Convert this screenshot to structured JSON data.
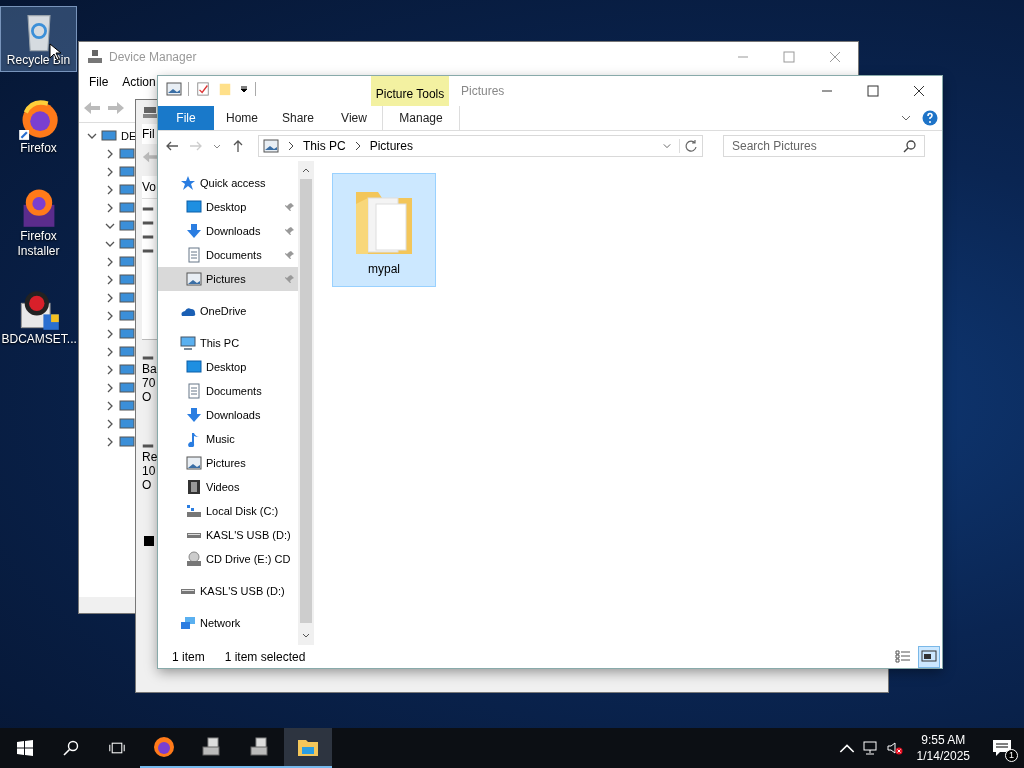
{
  "desktop_icons": [
    {
      "label": "Recycle Bin",
      "kind": "recycle-bin",
      "selected": true
    },
    {
      "label": "Firefox",
      "kind": "firefox",
      "selected": false
    },
    {
      "label": "Firefox Installer",
      "kind": "installer",
      "selected": false
    },
    {
      "label": "BDCAMSET...",
      "kind": "setup",
      "selected": false
    }
  ],
  "device_manager": {
    "title": "Device Manager",
    "menu": [
      "File",
      "Action"
    ],
    "tree": [
      {
        "label": "DE",
        "expanded": true
      },
      {
        "expanded": false
      },
      {
        "expanded": false
      },
      {
        "expanded": false
      },
      {
        "expanded": false
      },
      {
        "expanded": true
      },
      {
        "expanded": true
      },
      {
        "expanded": false
      },
      {
        "expanded": false
      },
      {
        "expanded": false
      },
      {
        "expanded": false
      },
      {
        "expanded": false
      },
      {
        "expanded": false
      },
      {
        "expanded": false
      },
      {
        "expanded": false
      },
      {
        "expanded": false
      },
      {
        "expanded": false
      },
      {
        "expanded": false
      }
    ]
  },
  "second_window": {
    "menu": "Fil",
    "column": "Vo",
    "details": [
      [
        "Ba",
        "70",
        "O"
      ],
      [
        "Re",
        "10",
        "O"
      ]
    ]
  },
  "explorer": {
    "contextual_tab": "Picture Tools",
    "title": "Pictures",
    "tabs": [
      {
        "label": "File",
        "kind": "file",
        "selected": false
      },
      {
        "label": "Home",
        "kind": "tab",
        "selected": false
      },
      {
        "label": "Share",
        "kind": "tab",
        "selected": false
      },
      {
        "label": "View",
        "kind": "tab",
        "selected": false
      },
      {
        "label": "Manage",
        "kind": "contextual",
        "selected": false
      }
    ],
    "address": [
      "This PC",
      "Pictures"
    ],
    "search": {
      "placeholder": "Search Pictures"
    },
    "nav": [
      {
        "label": "Quick access",
        "kind": "star",
        "selected": false,
        "children": [
          {
            "label": "Desktop",
            "kind": "desktop",
            "selected": false,
            "pinned": true
          },
          {
            "label": "Downloads",
            "kind": "download",
            "selected": false,
            "pinned": true
          },
          {
            "label": "Documents",
            "kind": "document",
            "selected": false,
            "pinned": true
          },
          {
            "label": "Pictures",
            "kind": "pictures",
            "selected": true,
            "pinned": true
          }
        ]
      },
      {
        "label": "OneDrive",
        "kind": "cloud",
        "selected": false
      },
      {
        "label": "This PC",
        "kind": "computer",
        "selected": false,
        "children": [
          {
            "label": "Desktop",
            "kind": "desktop",
            "selected": false,
            "pinned": false
          },
          {
            "label": "Documents",
            "kind": "document",
            "selected": false,
            "pinned": false
          },
          {
            "label": "Downloads",
            "kind": "download",
            "selected": false,
            "pinned": false
          },
          {
            "label": "Music",
            "kind": "music",
            "selected": false,
            "pinned": false
          },
          {
            "label": "Pictures",
            "kind": "pictures",
            "selected": false,
            "pinned": false
          },
          {
            "label": "Videos",
            "kind": "video",
            "selected": false,
            "pinned": false
          },
          {
            "label": "Local Disk (C:)",
            "kind": "system-disk",
            "selected": false,
            "pinned": false
          },
          {
            "label": "KASL'S USB (D:)",
            "kind": "drive",
            "selected": false,
            "pinned": false
          },
          {
            "label": "CD Drive (E:) CD",
            "kind": "cd",
            "selected": false,
            "pinned": false
          }
        ]
      },
      {
        "label": "KASL'S USB (D:)",
        "kind": "drive",
        "selected": false
      },
      {
        "label": "Network",
        "kind": "network",
        "selected": false
      }
    ],
    "items": [
      {
        "label": "mypal",
        "selected": true
      }
    ],
    "status": {
      "count": "1 item",
      "selection": "1 item selected"
    },
    "view_modes": [
      {
        "kind": "details",
        "selected": false
      },
      {
        "kind": "large-icons",
        "selected": true
      }
    ]
  },
  "taskbar": {
    "apps": [
      {
        "kind": "firefox",
        "running": true,
        "selected": false
      },
      {
        "kind": "device",
        "running": true,
        "selected": false
      },
      {
        "kind": "device",
        "running": true,
        "selected": false
      },
      {
        "kind": "folder",
        "running": true,
        "selected": true
      }
    ],
    "tray": {
      "volume_muted": true
    },
    "clock": {
      "time": "9:55 AM",
      "date": "1/14/2025"
    },
    "notifications": "1"
  }
}
